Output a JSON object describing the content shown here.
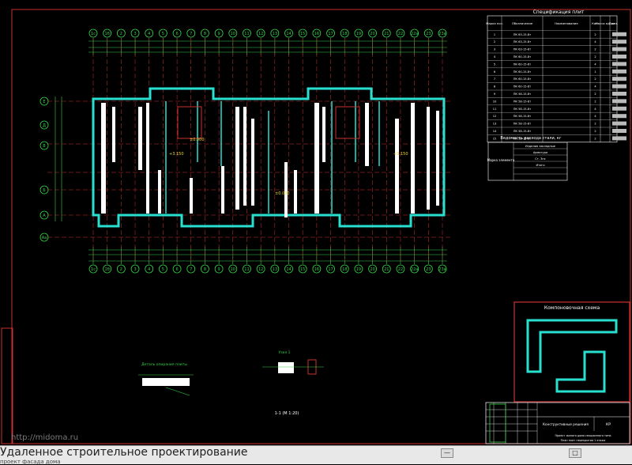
{
  "watermark": "http://midoma.ru",
  "caption": {
    "title": "Удаленное строительное проектирование",
    "subtitle": "проект фасада дома"
  },
  "window_buttons": {
    "minimize": "—",
    "maximize": "□"
  },
  "colors": {
    "grid_green": "#36d24a",
    "axis_red": "#d23030",
    "wall_cyan": "#28e0d0",
    "white": "#ffffff",
    "frame_red": "#c83232",
    "yellow": "#e8d838"
  },
  "drawing": {
    "top_axes": [
      "1с",
      "1б",
      "2",
      "3",
      "4",
      "5",
      "6",
      "7",
      "8",
      "9",
      "10",
      "11",
      "12",
      "13",
      "14",
      "15",
      "16",
      "17",
      "18",
      "19",
      "20",
      "21",
      "22",
      "22а",
      "23",
      "23а"
    ],
    "left_axes": [
      "Е",
      "Д",
      "В",
      "Б",
      "А",
      "Аа"
    ],
    "elevation_labels": [
      "+3.150",
      "+3.150",
      "±0.000",
      "±0.000"
    ],
    "spec_table": {
      "title": "Спецификация плит",
      "headers": [
        "Марка поз.",
        "Обозначение",
        "Наименование",
        "Кол.",
        "Масса ед. кг",
        "Прим."
      ],
      "rows": [
        [
          "1",
          "ПК 63-15-8т",
          "",
          "2",
          "",
          ""
        ],
        [
          "2",
          "ПК 63-15-8т",
          "",
          "4",
          "",
          ""
        ],
        [
          "3",
          "ПК 63-15-8т",
          "",
          "2",
          "",
          ""
        ],
        [
          "4",
          "ПК 60-15-8т",
          "",
          "2",
          "",
          ""
        ],
        [
          "5",
          "ПК 60-15-8т",
          "",
          "4",
          "",
          ""
        ],
        [
          "6",
          "ПК 60-15-8т",
          "",
          "1",
          "",
          ""
        ],
        [
          "7",
          "ПК 60-15-8т",
          "",
          "2",
          "",
          ""
        ],
        [
          "8",
          "ПК 60-15-8т",
          "",
          "4",
          "",
          ""
        ],
        [
          "9",
          "ПК 58-15-8т",
          "",
          "2",
          "",
          ""
        ],
        [
          "10",
          "ПК 58-15-8т",
          "",
          "2",
          "",
          ""
        ],
        [
          "11",
          "ПК 58-15-8т",
          "",
          "4",
          "",
          ""
        ],
        [
          "12",
          "ПК 58-15-8т",
          "",
          "4",
          "",
          ""
        ],
        [
          "13",
          "ПК 58-15-8т",
          "",
          "2",
          "",
          ""
        ],
        [
          "14",
          "ПК 58-15-8т",
          "",
          "2",
          "",
          ""
        ],
        [
          "15",
          "ПК 58-15-8т",
          "",
          "2",
          "",
          ""
        ]
      ]
    },
    "lintel_table": {
      "title": "Ведомость расхода стали, кг",
      "row_label": "Марка элемента",
      "cells": [
        "Изделия закладные",
        "Арматура",
        "Ст. 3пс",
        "Итого",
        "",
        "",
        ""
      ]
    },
    "scheme": {
      "title": "Компоновочная схема"
    },
    "detail1_title": "Деталь опирания плиты",
    "detail2_title": "Узел 1",
    "detail2_caption": "1-1 (М 1:20)",
    "title_block": {
      "name": "Конструктивные решения",
      "code": "КР",
      "org": "Проект жилого дома секционного типа",
      "sheet": "План плит перекрытия 1 этажа"
    }
  }
}
